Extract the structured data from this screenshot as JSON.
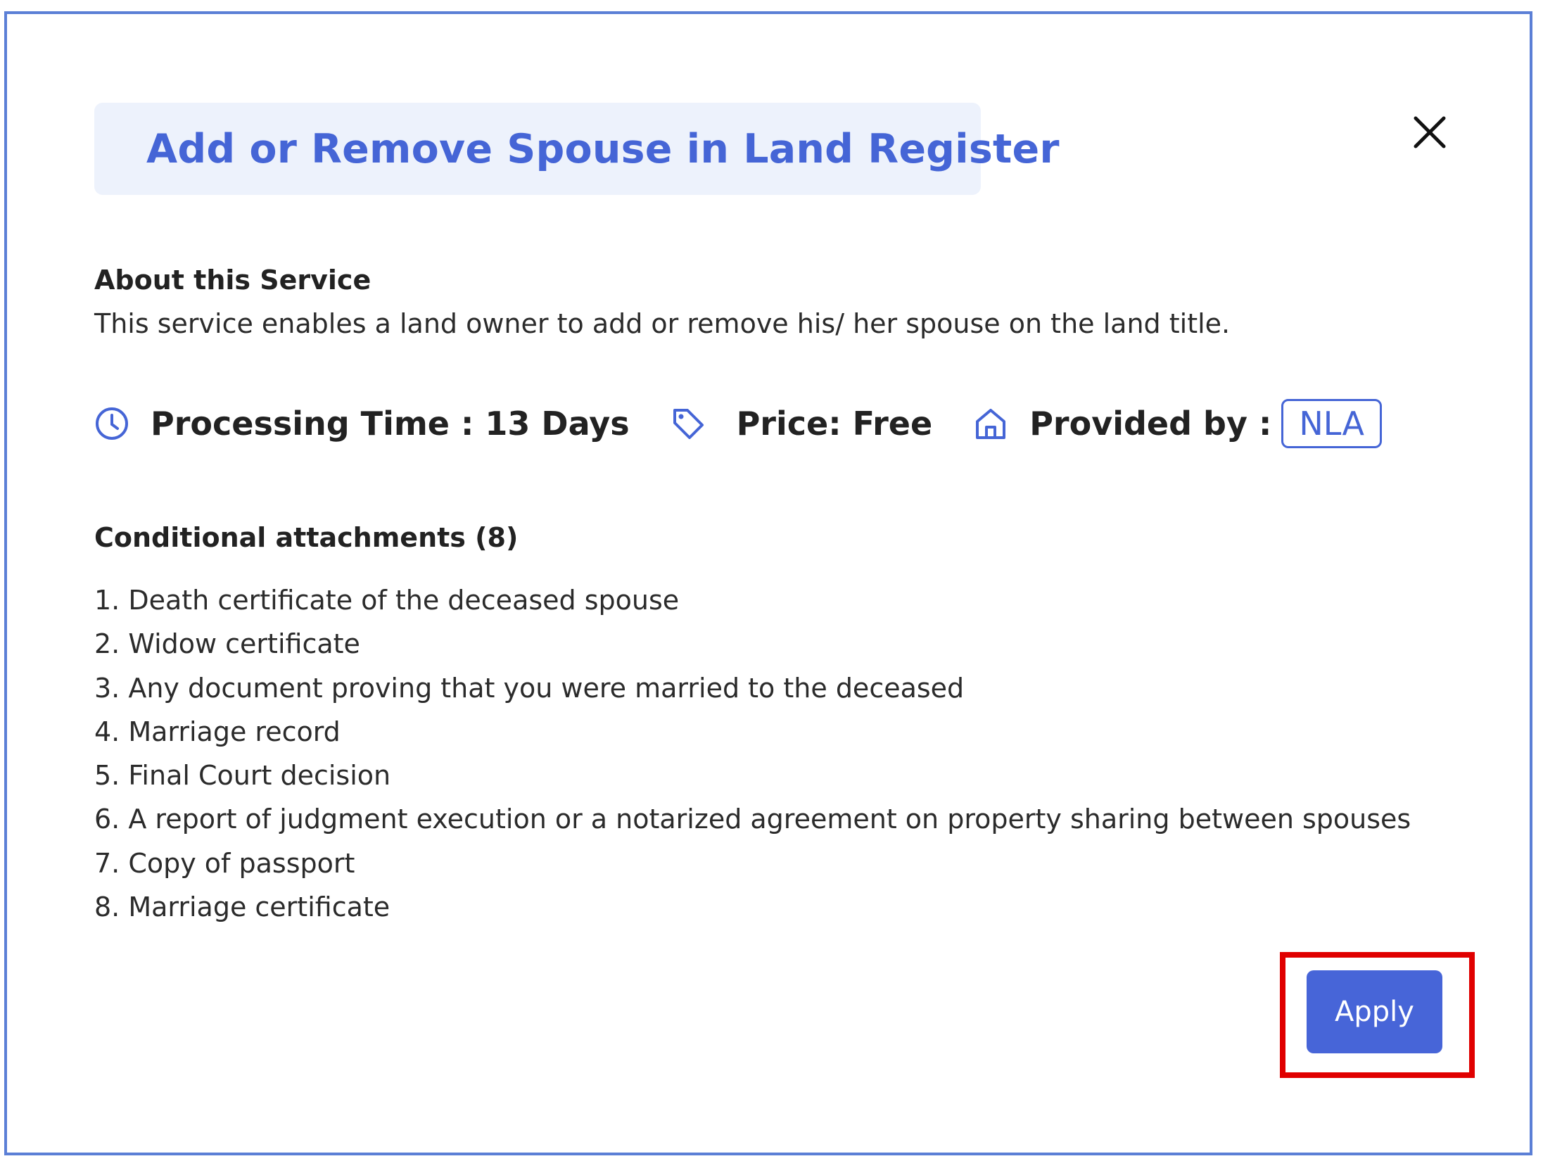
{
  "dialog": {
    "title": "Add or Remove Spouse in Land Register",
    "close_icon": "close-icon"
  },
  "about": {
    "heading": "About this Service",
    "description": "This service enables a land owner to add or remove his/ her spouse on the land title."
  },
  "meta": {
    "processing_icon": "clock-icon",
    "processing_time": "Processing Time : 13 Days",
    "price_icon": "tag-icon",
    "price": "Price: Free",
    "provider_icon": "home-icon",
    "provided_by_label": "Provided by :",
    "provider_badge": "NLA"
  },
  "attachments": {
    "heading": "Conditional attachments (8)",
    "items": [
      "1. Death certificate of the deceased spouse",
      "2. Widow certificate",
      "3. Any document proving that you were married to the deceased",
      "4. Marriage record",
      "5. Final Court decision",
      "6. A report of judgment execution or a notarized agreement on property sharing between spouses",
      "7. Copy of passport",
      "8. Marriage certificate"
    ]
  },
  "actions": {
    "apply_label": "Apply"
  },
  "colors": {
    "accent": "#4565d6",
    "title_bg": "#edf2fc",
    "frame_border": "#5b7fd6",
    "highlight": "#e00000",
    "button_bg": "#4765d8"
  }
}
